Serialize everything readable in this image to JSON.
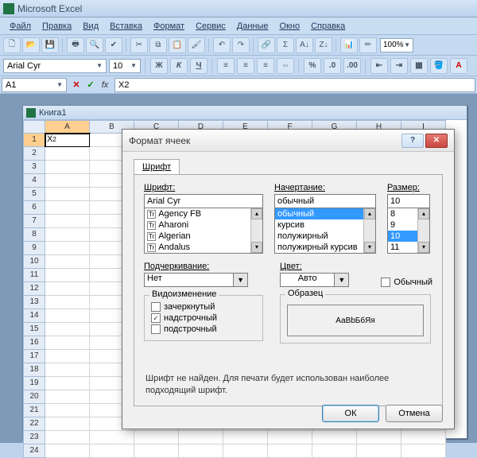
{
  "app": {
    "title": "Microsoft Excel"
  },
  "menu": {
    "file": "Файл",
    "edit": "Правка",
    "view": "Вид",
    "insert": "Вставка",
    "format": "Формат",
    "tools": "Сервис",
    "data": "Данные",
    "window": "Окно",
    "help": "Справка"
  },
  "toolbar": {
    "zoom": "100%"
  },
  "fmt": {
    "font": "Arial Cyr",
    "size": "10"
  },
  "fbar": {
    "name": "A1",
    "formula": "X2"
  },
  "wb": {
    "title": "Книга1",
    "cols": [
      "A",
      "B",
      "C",
      "D",
      "E",
      "F",
      "G",
      "H",
      "I"
    ],
    "rows": 24,
    "cellA1_base": "X",
    "cellA1_sup": "2"
  },
  "dlg": {
    "title": "Формат ячеек",
    "tab": "Шрифт",
    "lbl_font": "Шрифт:",
    "lbl_style": "Начертание:",
    "lbl_size": "Размер:",
    "font_val": "Arial Cyr",
    "fonts": [
      "Agency FB",
      "Aharoni",
      "Algerian",
      "Andalus"
    ],
    "style_val": "обычный",
    "styles": [
      "обычный",
      "курсив",
      "полужирный",
      "полужирный курсив"
    ],
    "style_sel_index": 0,
    "size_val": "10",
    "sizes": [
      "8",
      "9",
      "10",
      "11"
    ],
    "size_sel_index": 2,
    "lbl_underline": "Подчеркивание:",
    "underline_val": "Нет",
    "lbl_color": "Цвет:",
    "color_val": "Авто",
    "chk_normal": "Обычный",
    "grp_effects": "Видоизменение",
    "chk_strike": "зачеркнутый",
    "chk_super": "надстрочный",
    "chk_sub": "подстрочный",
    "grp_sample": "Образец",
    "sample_text": "АаВbБбЯя",
    "note": "Шрифт не найден. Для печати будет использован наиболее подходящий шрифт.",
    "ok": "ОК",
    "cancel": "Отмена"
  },
  "chart_data": null
}
